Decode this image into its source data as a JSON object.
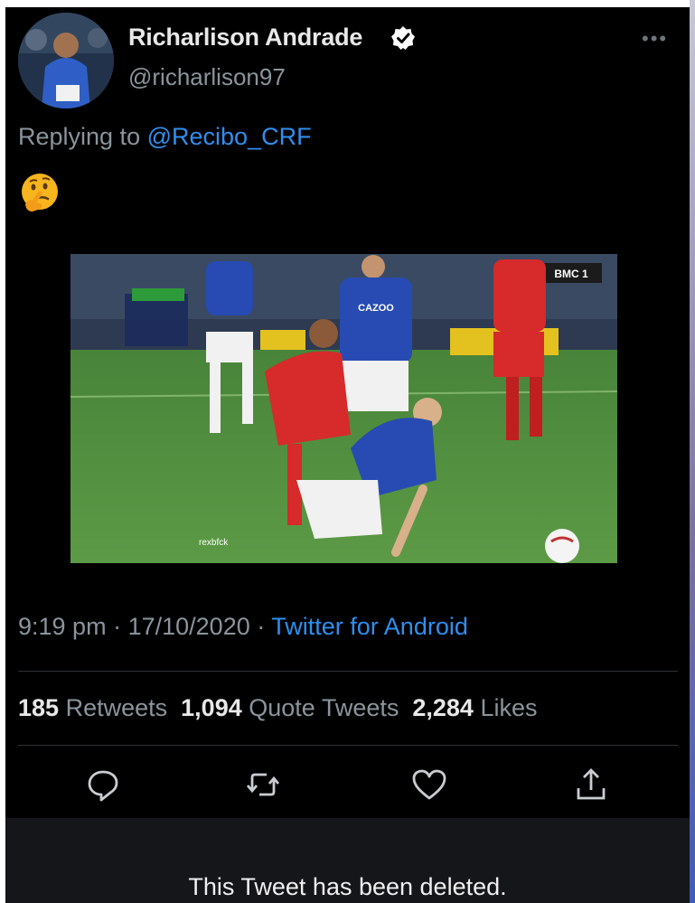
{
  "tweet": {
    "author_name": "Richarlison Andrade",
    "author_handle": "@richarlison97",
    "more_label": "•••",
    "replying_prefix": "Replying to",
    "replying_to": "@Recibo_CRF",
    "body_emoji_name": "thinking-face-emoji",
    "time": "9:19 pm",
    "date": "17/10/2020",
    "source": "Twitter for Android",
    "separator": "·"
  },
  "media": {
    "sponsor_text": "CAZOO",
    "watermark": "rexbfck",
    "broadcaster": "BMC 1"
  },
  "stats": {
    "retweets_count": "185",
    "retweets_label": "Retweets",
    "quotes_count": "1,094",
    "quotes_label": "Quote Tweets",
    "likes_count": "2,284",
    "likes_label": "Likes"
  },
  "actions": {
    "reply": "reply-icon",
    "retweet": "retweet-icon",
    "like": "heart-icon",
    "share": "share-icon"
  },
  "footer": {
    "deleted_text": "This Tweet has been deleted."
  },
  "colors": {
    "background": "#000000",
    "link_blue": "#2f8ff0",
    "secondary_text": "#8b949c",
    "everton_blue": "#274bb2",
    "liverpool_red": "#d72a2a"
  }
}
